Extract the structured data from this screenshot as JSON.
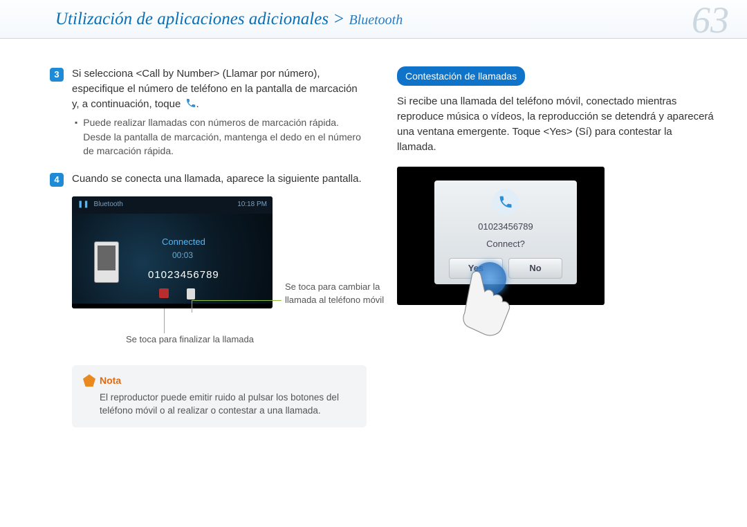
{
  "header": {
    "breadcrumb_main": "Utilización de aplicaciones adicionales",
    "breadcrumb_sep": ">",
    "breadcrumb_sub": "Bluetooth",
    "page_number": "63"
  },
  "left": {
    "step3": {
      "num": "3",
      "text_a": "Si selecciona <Call by Number> (Llamar por número), especifique el número de teléfono en la pantalla de marcación y, a continuación, toque ",
      "bullet": "Puede realizar llamadas con números de marcación rápida. Desde la pantalla de marcación, mantenga el dedo en el número de marcación rápida."
    },
    "step4": {
      "num": "4",
      "text": "Cuando se conecta una llamada, aparece la siguiente pantalla."
    },
    "screenshot1": {
      "top_left": "Bluetooth",
      "top_right": "10:18 PM",
      "connected": "Connected",
      "duration": "00:03",
      "number": "01023456789"
    },
    "callout_endcall": "Se toca para finalizar la llamada",
    "callout_switch": "Se toca para cambiar la llamada al teléfono móvil",
    "nota": {
      "label": "Nota",
      "text": "El reproductor puede emitir ruido al pulsar los botones del teléfono móvil o al realizar o contestar a una llamada."
    }
  },
  "right": {
    "pill": "Contestación de llamadas",
    "para": "Si recibe una llamada del teléfono móvil, conectado mientras reproduce música o vídeos, la reproducción se detendrá y aparecerá una ventana emergente. Toque <Yes> (Sí) para contestar la llamada.",
    "screenshot2": {
      "number": "01023456789",
      "question": "Connect?",
      "yes": "Yes",
      "no": "No"
    }
  }
}
